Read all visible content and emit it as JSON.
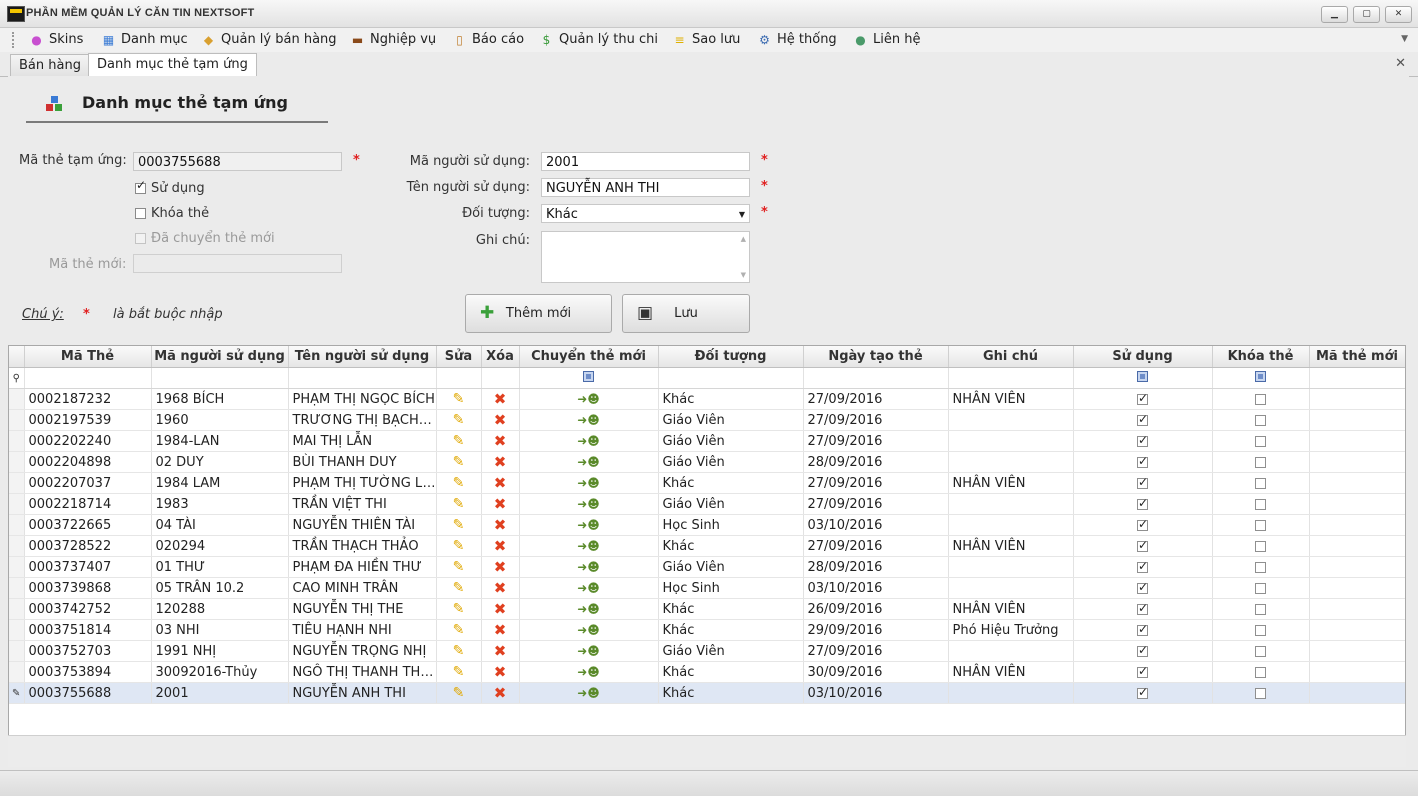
{
  "window": {
    "title": "PHẦN MỀM QUẢN LÝ CĂN TIN NEXTSOFT",
    "controls": [
      "▁",
      "▢",
      "✕"
    ]
  },
  "menu": [
    {
      "label": "Skins",
      "icon": "palette-icon",
      "glyph": "●",
      "color": "#c84fd0"
    },
    {
      "label": "Danh mục",
      "icon": "grid-icon",
      "glyph": "▦",
      "color": "#3a7bd5"
    },
    {
      "label": "Quản lý bán hàng",
      "icon": "tag-icon",
      "glyph": "◆",
      "color": "#d9a030"
    },
    {
      "label": "Nghiệp vụ",
      "icon": "briefcase-icon",
      "glyph": "▬",
      "color": "#8a4a1a"
    },
    {
      "label": "Báo cáo",
      "icon": "clipboard-icon",
      "glyph": "▯",
      "color": "#c08030"
    },
    {
      "label": "Quản lý thu chi",
      "icon": "money-icon",
      "glyph": "$",
      "color": "#3a9a3a"
    },
    {
      "label": "Sao lưu",
      "icon": "database-icon",
      "glyph": "≡",
      "color": "#e0b000"
    },
    {
      "label": "Hệ thống",
      "icon": "gears-icon",
      "glyph": "⚙",
      "color": "#3a6ab0"
    },
    {
      "label": "Liên hệ",
      "icon": "person-icon",
      "glyph": "●",
      "color": "#4a9a6a"
    }
  ],
  "tabs": [
    {
      "label": "Bán hàng",
      "active": false
    },
    {
      "label": "Danh mục thẻ tạm ứng",
      "active": true
    }
  ],
  "tab_close": "✕",
  "form": {
    "title": "Danh mục thẻ tạm ứng",
    "ma_the_label": "Mã thẻ tạm ứng:",
    "ma_the_value": "0003755688",
    "su_dung_label": "Sử dụng",
    "su_dung_checked": true,
    "khoa_the_label": "Khóa thẻ",
    "khoa_the_checked": false,
    "da_chuyen_label": "Đã chuyển thẻ mới",
    "da_chuyen_checked": false,
    "ma_the_moi_label": "Mã thẻ mới:",
    "ma_the_moi_value": "",
    "ma_nguoi_label": "Mã người sử dụng:",
    "ma_nguoi_value": "2001",
    "ten_nguoi_label": "Tên người sử dụng:",
    "ten_nguoi_value": "NGUYỄN ANH THI",
    "doi_tuong_label": "Đối tượng:",
    "doi_tuong_value": "Khác",
    "ghi_chu_label": "Ghi chú:",
    "ghi_chu_value": "",
    "required_mark": "*",
    "note_label": "Chú ý:",
    "note_text": "là bắt buộc nhập",
    "btn_them_moi": "Thêm mới",
    "btn_luu": "Lưu"
  },
  "grid": {
    "columns": [
      "Mã Thẻ",
      "Mã người sử dụng",
      "Tên người sử dụng",
      "Sửa",
      "Xóa",
      "Chuyển thẻ mới",
      "Đối tượng",
      "Ngày tạo thẻ",
      "Ghi chú",
      "Sử dụng",
      "Khóa thẻ",
      "Mã thẻ mới"
    ],
    "rows": [
      {
        "ma_the": "0002187232",
        "ma_nguoi": "1968 BÍCH",
        "ten": "PHẠM THỊ NGỌC BÍCH",
        "doi_tuong": "Khác",
        "ngay": "27/09/2016",
        "ghi_chu": "NHÂN VIÊN",
        "su_dung": true,
        "khoa": false,
        "ma_moi": ""
      },
      {
        "ma_the": "0002197539",
        "ma_nguoi": "1960",
        "ten": "TRƯƠNG THỊ BẠCH H...",
        "doi_tuong": "Giáo Viên",
        "ngay": "27/09/2016",
        "ghi_chu": "",
        "su_dung": true,
        "khoa": false,
        "ma_moi": ""
      },
      {
        "ma_the": "0002202240",
        "ma_nguoi": "1984-LAN",
        "ten": "MAI THỊ LẪN",
        "doi_tuong": "Giáo Viên",
        "ngay": "27/09/2016",
        "ghi_chu": "",
        "su_dung": true,
        "khoa": false,
        "ma_moi": ""
      },
      {
        "ma_the": "0002204898",
        "ma_nguoi": "02 DUY",
        "ten": "BÙI THANH DUY",
        "doi_tuong": "Giáo Viên",
        "ngay": "28/09/2016",
        "ghi_chu": "",
        "su_dung": true,
        "khoa": false,
        "ma_moi": ""
      },
      {
        "ma_the": "0002207037",
        "ma_nguoi": "1984 LAM",
        "ten": "PHẠM THỊ TƯỜNG LAM",
        "doi_tuong": "Khác",
        "ngay": "27/09/2016",
        "ghi_chu": "NHÂN VIÊN",
        "su_dung": true,
        "khoa": false,
        "ma_moi": ""
      },
      {
        "ma_the": "0002218714",
        "ma_nguoi": "1983",
        "ten": "TRẦN VIỆT THI",
        "doi_tuong": "Giáo Viên",
        "ngay": "27/09/2016",
        "ghi_chu": "",
        "su_dung": true,
        "khoa": false,
        "ma_moi": ""
      },
      {
        "ma_the": "0003722665",
        "ma_nguoi": "04 TÀI",
        "ten": "NGUYỄN THIÊN TÀI",
        "doi_tuong": "Học Sinh",
        "ngay": "03/10/2016",
        "ghi_chu": "",
        "su_dung": true,
        "khoa": false,
        "ma_moi": ""
      },
      {
        "ma_the": "0003728522",
        "ma_nguoi": "020294",
        "ten": "TRẦN THẠCH THẢO",
        "doi_tuong": "Khác",
        "ngay": "27/09/2016",
        "ghi_chu": "NHÂN VIÊN",
        "su_dung": true,
        "khoa": false,
        "ma_moi": ""
      },
      {
        "ma_the": "0003737407",
        "ma_nguoi": "01 THƯ",
        "ten": "PHẠM ĐA HIỀN THƯ",
        "doi_tuong": "Giáo Viên",
        "ngay": "28/09/2016",
        "ghi_chu": "",
        "su_dung": true,
        "khoa": false,
        "ma_moi": ""
      },
      {
        "ma_the": "0003739868",
        "ma_nguoi": "05 TRÂN 10.2",
        "ten": "CAO MINH TRÂN",
        "doi_tuong": "Học Sinh",
        "ngay": "03/10/2016",
        "ghi_chu": "",
        "su_dung": true,
        "khoa": false,
        "ma_moi": ""
      },
      {
        "ma_the": "0003742752",
        "ma_nguoi": "120288",
        "ten": "NGUYỄN THỊ THE",
        "doi_tuong": "Khác",
        "ngay": "26/09/2016",
        "ghi_chu": "NHÂN VIÊN",
        "su_dung": true,
        "khoa": false,
        "ma_moi": ""
      },
      {
        "ma_the": "0003751814",
        "ma_nguoi": "03 NHI",
        "ten": "TIÊU HẠNH NHI",
        "doi_tuong": "Khác",
        "ngay": "29/09/2016",
        "ghi_chu": "Phó Hiệu Trưởng",
        "su_dung": true,
        "khoa": false,
        "ma_moi": ""
      },
      {
        "ma_the": "0003752703",
        "ma_nguoi": "1991 NHỊ",
        "ten": "NGUYỄN TRỌNG NHỊ",
        "doi_tuong": "Giáo Viên",
        "ngay": "27/09/2016",
        "ghi_chu": "",
        "su_dung": true,
        "khoa": false,
        "ma_moi": ""
      },
      {
        "ma_the": "0003753894",
        "ma_nguoi": "30092016-Thủy",
        "ten": "NGÔ THỊ THANH THỦY",
        "doi_tuong": "Khác",
        "ngay": "30/09/2016",
        "ghi_chu": "NHÂN VIÊN",
        "su_dung": true,
        "khoa": false,
        "ma_moi": ""
      },
      {
        "ma_the": "0003755688",
        "ma_nguoi": "2001",
        "ten": "NGUYỄN ANH THI",
        "doi_tuong": "Khác",
        "ngay": "03/10/2016",
        "ghi_chu": "",
        "su_dung": true,
        "khoa": false,
        "ma_moi": "",
        "selected": true
      }
    ]
  },
  "colors": {
    "required": "#e02020",
    "selected_row": "#dfe7f4",
    "accent_title": "#f2c400"
  }
}
